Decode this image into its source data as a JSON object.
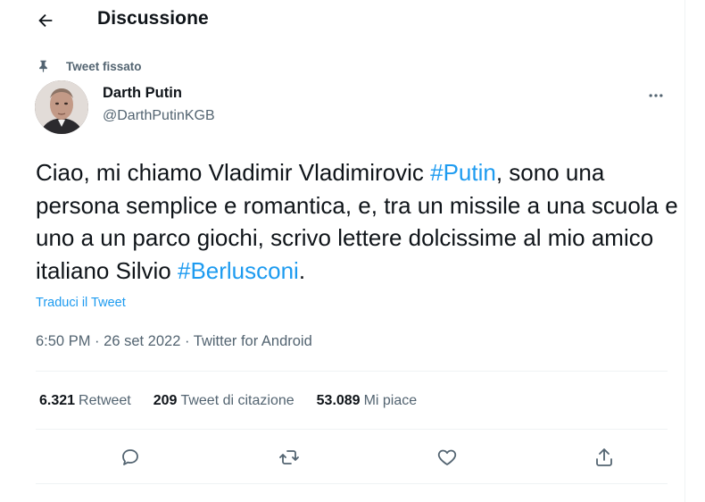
{
  "header": {
    "title": "Discussione",
    "back_icon": "arrow-left-icon"
  },
  "pinned": {
    "label": "Tweet fissato",
    "icon": "pin-icon"
  },
  "author": {
    "name": "Darth Putin",
    "handle": "@DarthPutinKGB"
  },
  "tweet": {
    "text_before": "Ciao, mi chiamo Vladimir Vladimirovic ",
    "hashtag1": "#Putin",
    "text_middle": ", sono una persona semplice e romantica, e, tra un missile a una scuola e uno a un parco giochi, scrivo lettere dolcissime al mio amico italiano Silvio ",
    "hashtag2": "#Berlusconi",
    "text_after": ".",
    "translate_label": "Traduci il Tweet",
    "time": "6:50 PM",
    "separator": "·",
    "date": "26 set 2022",
    "source": "Twitter for Android"
  },
  "stats": {
    "retweets_count": "6.321",
    "retweets_label": "Retweet",
    "quotes_count": "209",
    "quotes_label": "Tweet di citazione",
    "likes_count": "53.089",
    "likes_label": "Mi piace"
  },
  "colors": {
    "accent": "#1d9bf0",
    "text_primary": "#0f1419",
    "text_secondary": "#536471",
    "divider": "#eff3f4"
  }
}
